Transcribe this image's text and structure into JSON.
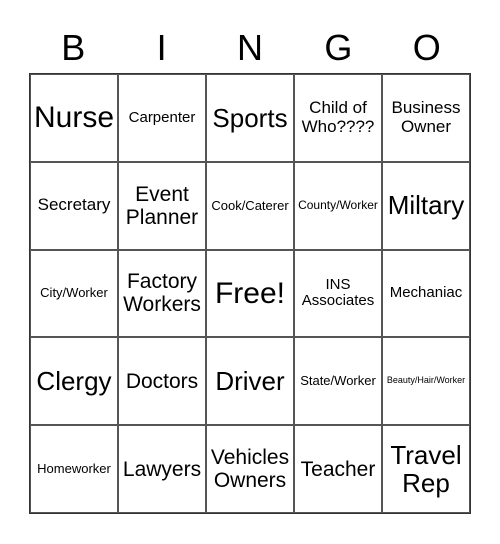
{
  "header": {
    "letters": [
      "B",
      "I",
      "N",
      "G",
      "O"
    ]
  },
  "grid": {
    "rows": [
      [
        {
          "text": "Nurse",
          "size": "xl"
        },
        {
          "text": "Carpenter",
          "size": "s"
        },
        {
          "text": "Sports",
          "size": "l"
        },
        {
          "text": "Child of\nWho????",
          "size": "ms"
        },
        {
          "text": "Business\nOwner",
          "size": "ms"
        }
      ],
      [
        {
          "text": "Secretary",
          "size": "ms"
        },
        {
          "text": "Event\nPlanner",
          "size": "m"
        },
        {
          "text": "Cook/Caterer",
          "size": "xs"
        },
        {
          "text": "County/Worker",
          "size": "xxs"
        },
        {
          "text": "Miltary",
          "size": "l"
        }
      ],
      [
        {
          "text": "City/Worker",
          "size": "xs"
        },
        {
          "text": "Factory\nWorkers",
          "size": "m"
        },
        {
          "text": "Free!",
          "size": "xl"
        },
        {
          "text": "INS\nAssociates",
          "size": "s"
        },
        {
          "text": "Mechaniac",
          "size": "s"
        }
      ],
      [
        {
          "text": "Clergy",
          "size": "l"
        },
        {
          "text": "Doctors",
          "size": "m"
        },
        {
          "text": "Driver",
          "size": "l"
        },
        {
          "text": "State/Worker",
          "size": "xs"
        },
        {
          "text": "Beauty/Hair/Worker",
          "size": "tiny"
        }
      ],
      [
        {
          "text": "Homeworker",
          "size": "xs"
        },
        {
          "text": "Lawyers",
          "size": "m"
        },
        {
          "text": "Vehicles\nOwners",
          "size": "m"
        },
        {
          "text": "Teacher",
          "size": "m"
        },
        {
          "text": "Travel\nRep",
          "size": "l"
        }
      ]
    ]
  }
}
